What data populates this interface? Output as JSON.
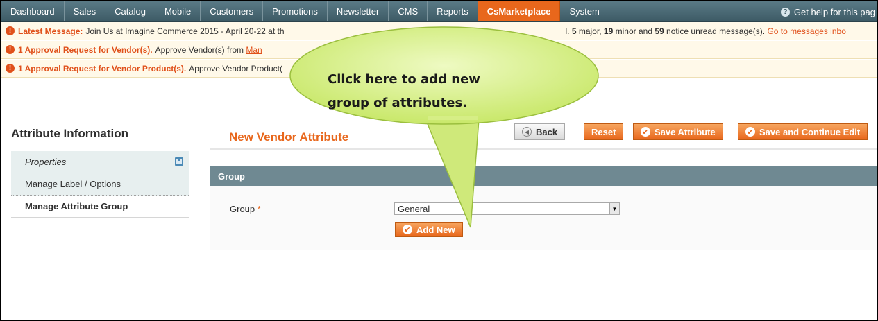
{
  "nav": {
    "items": [
      "Dashboard",
      "Sales",
      "Catalog",
      "Mobile",
      "Customers",
      "Promotions",
      "Newsletter",
      "CMS",
      "Reports",
      "CsMarketplace",
      "System"
    ],
    "active": "CsMarketplace",
    "help_label": "Get help for this pag"
  },
  "notices": {
    "latest_label": "Latest Message:",
    "latest_text": "Join Us at Imagine Commerce 2015 - April 20-22 at th",
    "latest_tail_1": "l.",
    "latest_count_major": "5",
    "latest_text_major": "major,",
    "latest_count_minor": "19",
    "latest_text_minor": "minor and",
    "latest_count_notice": "59",
    "latest_text_notice": "notice unread message(s).",
    "latest_link": "Go to messages inbo",
    "vendor_label": "1 Approval Request for Vendor(s).",
    "vendor_text": "Approve Vendor(s) from",
    "vendor_link": "Man",
    "product_label": "1 Approval Request for Vendor Product(s).",
    "product_text": "Approve Vendor Product("
  },
  "sidebar": {
    "title": "Attribute Information",
    "tabs": [
      "Properties",
      "Manage Label / Options",
      "Manage Attribute Group"
    ]
  },
  "main": {
    "title": "New Vendor Attribute",
    "buttons": {
      "back": "Back",
      "reset": "Reset",
      "save": "Save Attribute",
      "save_continue": "Save and Continue Edit"
    },
    "section_title": "Group",
    "field_label": "Group",
    "required_mark": "*",
    "select_value": "General",
    "add_new": "Add New"
  },
  "callout": {
    "line1": "Click  here  to  add  new",
    "line2": "group of attributes."
  },
  "colors": {
    "accent": "#e8671c",
    "nav_bg": "#4a6a75",
    "callout_fill": "#d6f08a"
  }
}
